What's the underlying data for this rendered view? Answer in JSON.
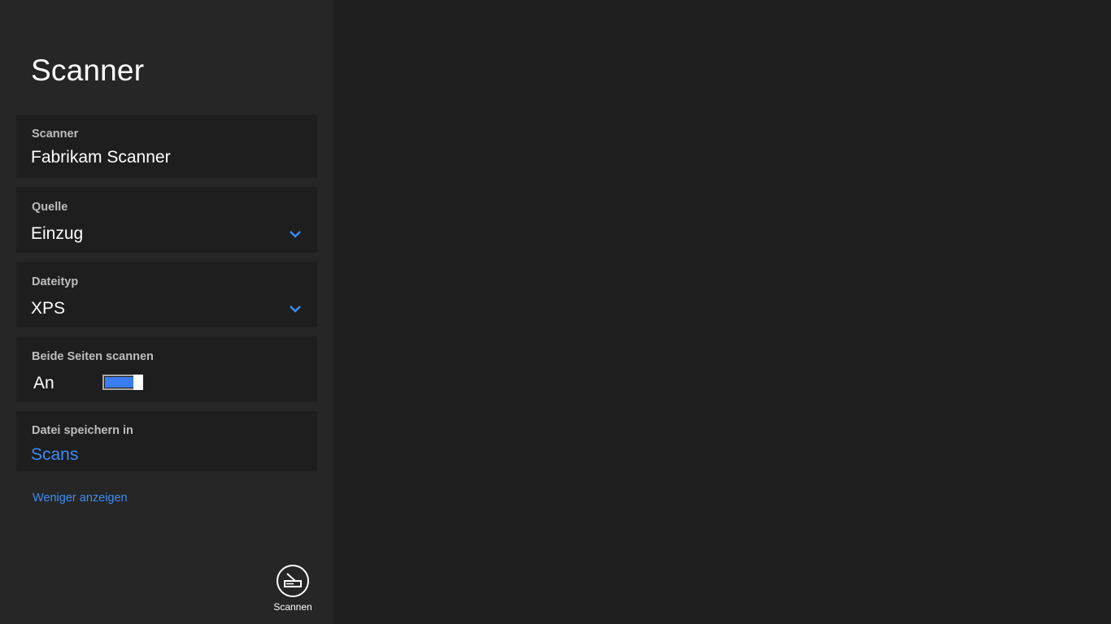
{
  "app": {
    "title": "Scanner"
  },
  "settings": {
    "scanner": {
      "label": "Scanner",
      "value": "Fabrikam Scanner"
    },
    "source": {
      "label": "Quelle",
      "value": "Einzug"
    },
    "file_type": {
      "label": "Dateityp",
      "value": "XPS"
    },
    "duplex": {
      "label": "Beide Seiten scannen",
      "value": "An",
      "enabled": true
    },
    "save_location": {
      "label": "Datei speichern in",
      "value": "Scans"
    }
  },
  "show_less_link": "Weniger anzeigen",
  "scan_button": {
    "label": "Scannen",
    "icon": "scanner-icon"
  },
  "colors": {
    "accent": "#3c8cf5",
    "sidebar_bg": "#262626",
    "card_bg": "#1e1e1e",
    "main_bg": "#1f1f1f"
  }
}
